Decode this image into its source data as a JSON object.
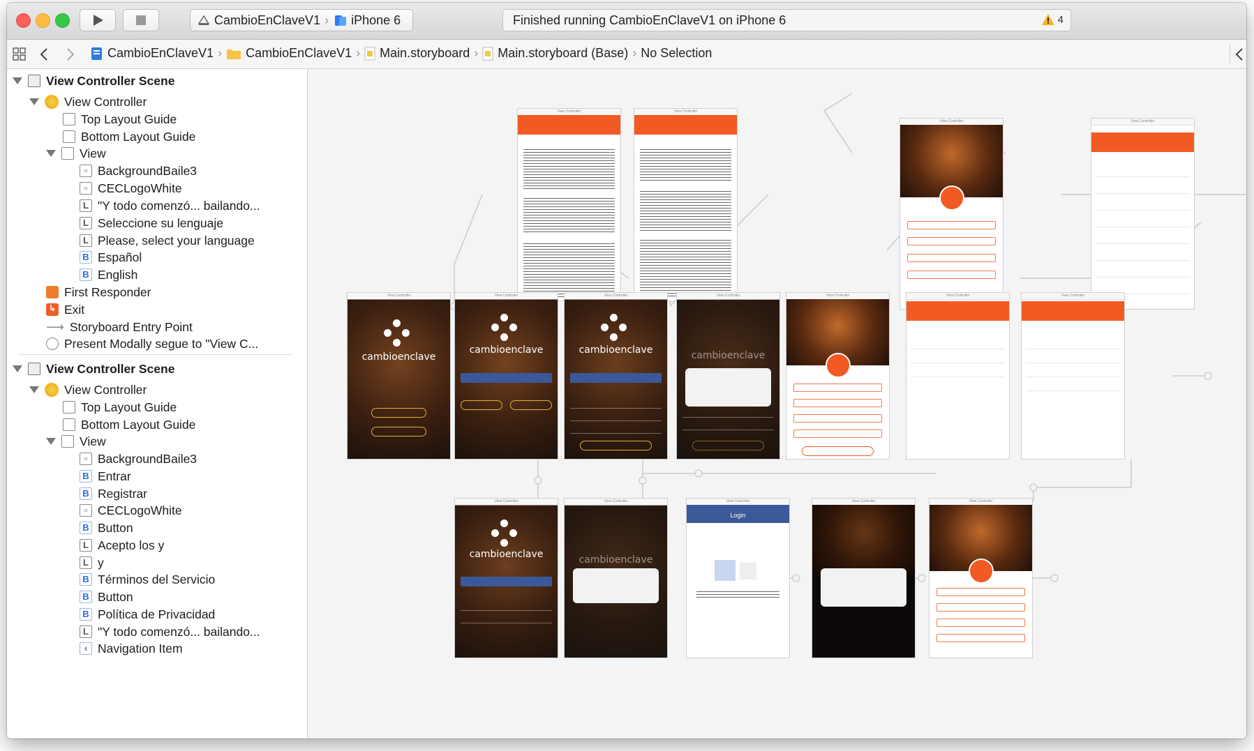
{
  "toolbar": {
    "scheme_name": "CambioEnClaveV1",
    "device_name": "iPhone 6",
    "status_text": "Finished running CambioEnClaveV1 on iPhone 6",
    "warning_count": "4",
    "colors": {
      "close": "#fc605b",
      "minimize": "#fdbc40",
      "zoom": "#34c84a"
    }
  },
  "jumpbar": {
    "crumbs": [
      "CambioEnClaveV1",
      "CambioEnClaveV1",
      "Main.storyboard",
      "Main.storyboard (Base)",
      "No Selection"
    ]
  },
  "outline": {
    "scene1": {
      "title": "View Controller Scene",
      "view_controller": "View Controller",
      "top_layout_guide": "Top Layout Guide",
      "bottom_layout_guide": "Bottom Layout Guide",
      "view": "View",
      "items": [
        {
          "icon": "image-view-icon",
          "label": "BackgroundBaile3"
        },
        {
          "icon": "image-view-icon",
          "label": "CECLogoWhite"
        },
        {
          "icon": "label-icon",
          "label": "\"Y todo comenzó... bailando..."
        },
        {
          "icon": "label-icon",
          "label": "Seleccione su lenguaje"
        },
        {
          "icon": "label-icon",
          "label": "Please, select your language"
        },
        {
          "icon": "button-icon",
          "label": "Español"
        },
        {
          "icon": "button-icon",
          "label": "English"
        }
      ],
      "first_responder": "First Responder",
      "exit": "Exit",
      "entry_point": "Storyboard Entry Point",
      "segue": "Present Modally segue to \"View C..."
    },
    "scene2": {
      "title": "View Controller Scene",
      "view_controller": "View Controller",
      "top_layout_guide": "Top Layout Guide",
      "bottom_layout_guide": "Bottom Layout Guide",
      "view": "View",
      "items": [
        {
          "icon": "image-view-icon",
          "label": "BackgroundBaile3"
        },
        {
          "icon": "button-icon",
          "label": "Entrar"
        },
        {
          "icon": "button-icon",
          "label": "Registrar"
        },
        {
          "icon": "image-view-icon",
          "label": "CECLogoWhite"
        },
        {
          "icon": "button-icon",
          "label": "Button"
        },
        {
          "icon": "label-icon",
          "label": "Acepto los y"
        },
        {
          "icon": "label-icon",
          "label": "y"
        },
        {
          "icon": "button-icon",
          "label": "Términos del Servicio"
        },
        {
          "icon": "button-icon",
          "label": "Button"
        },
        {
          "icon": "button-icon",
          "label": "Política de Privacidad"
        },
        {
          "icon": "label-icon",
          "label": "\"Y todo comenzó... bailando..."
        },
        {
          "icon": "navigation-item-icon",
          "label": "Navigation Item"
        }
      ]
    }
  },
  "canvas": {
    "scene_caption": "View Controller",
    "logo_text": "cambioenclave",
    "facebook_login_title": "Login",
    "accent": "#f25a24",
    "facebook_blue": "#3b5998"
  }
}
